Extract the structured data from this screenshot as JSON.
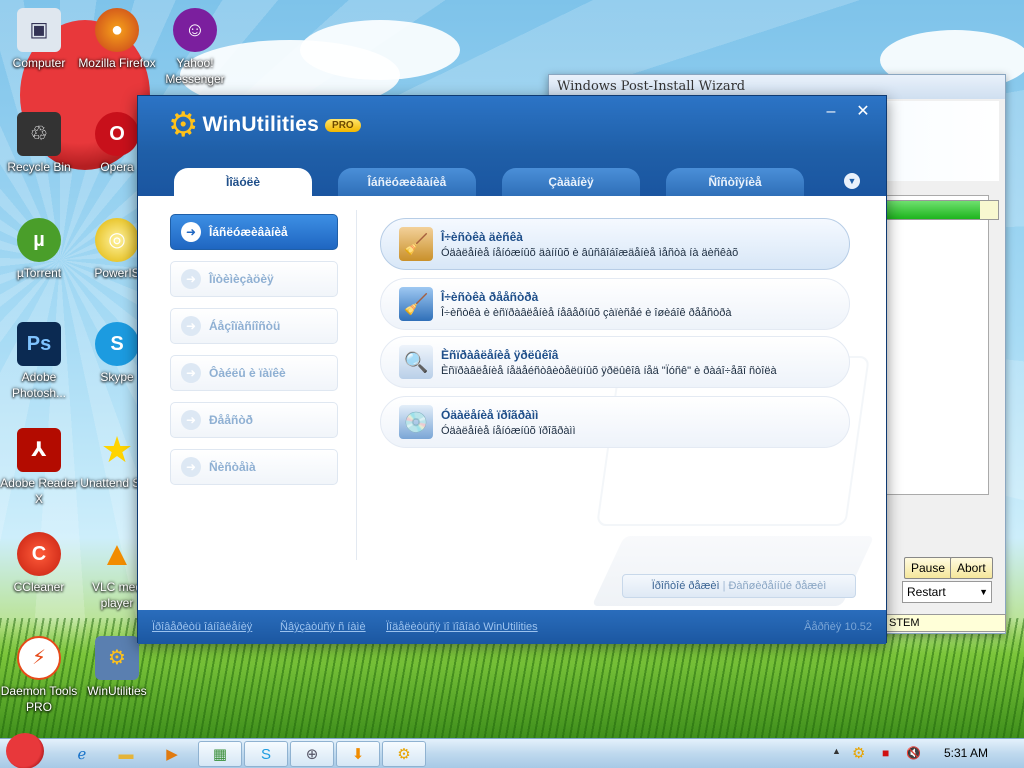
{
  "desktop": {
    "icons": [
      {
        "label": "Computer",
        "icon": "computer-icon"
      },
      {
        "label": "Mozilla Firefox",
        "icon": "firefox-icon"
      },
      {
        "label": "Yahoo! Messenger",
        "icon": "yahoo-messenger-icon"
      },
      {
        "label": "Recycle Bin",
        "icon": "recycle-bin-icon"
      },
      {
        "label": "Opera",
        "icon": "opera-icon"
      },
      {
        "label": "µTorrent",
        "icon": "utorrent-icon"
      },
      {
        "label": "PowerIS",
        "icon": "poweriso-icon"
      },
      {
        "label": "Adobe Photosh...",
        "icon": "photoshop-icon"
      },
      {
        "label": "Skype",
        "icon": "skype-icon"
      },
      {
        "label": "Adobe Reader X",
        "icon": "adobe-reader-icon"
      },
      {
        "label": "Unattend Soft",
        "icon": "star-icon"
      },
      {
        "label": "CCleaner",
        "icon": "ccleaner-icon"
      },
      {
        "label": "VLC med player",
        "icon": "vlc-icon"
      },
      {
        "label": "Daemon Tools PRO",
        "icon": "daemon-tools-icon"
      },
      {
        "label": "WinUtilities",
        "icon": "winutilities-icon"
      }
    ]
  },
  "wizard": {
    "title": "Windows Post-Install Wizard",
    "pause_label": "Pause",
    "abort_label": "Abort",
    "restart_value": "Restart",
    "status_text": "STEM",
    "progress": 0.85
  },
  "app": {
    "name": "WinUtilities",
    "badge": "PRO",
    "tabs": [
      "Ìîäóëè",
      "Îáñëóæèâàíèå",
      "Çàäàíèÿ",
      "Ñîñòîÿíèå"
    ],
    "nav": [
      "Îáñëóæèâàíèå",
      "Îïòèìèçàöèÿ",
      "Áåçîïàñíîñòü",
      "Ôàéëû è ïàïêè",
      "Ðååñòð",
      "Ñèñòåìà"
    ],
    "features": [
      {
        "title": "Î÷èñòêà äèñêà",
        "desc": "Óäàëåíèå íåíóæíûõ äàííûõ è âûñâîáîæäåíèå ìåñòà íà äèñêàõ",
        "icon": "disk-cleanup-icon"
      },
      {
        "title": "Î÷èñòêà ðååñòðà",
        "desc": "Î÷èñòêà è èñïðàâëåíèå íåâåðíûõ çàïèñåé è îøèáîê ðååñòðà",
        "icon": "registry-cleanup-icon"
      },
      {
        "title": "Èñïðàâëåíèå ÿðëûêîâ",
        "desc": "Èñïðàâëåíèå íåäåéñòâèòåëüíûõ ÿðëûêîâ íåä \"Ïóñê\" è ðàáî÷åãî ñòîëà",
        "icon": "shortcut-fix-icon"
      },
      {
        "title": "Óäàëåíèå ïðîãðàìì",
        "desc": "Óäàëåíèå íåíóæíûõ ïðîãðàìì",
        "icon": "uninstall-icon"
      }
    ],
    "mode": {
      "basic": "Ïðîñòîé ðåæèì",
      "advanced": "Ðàñøèðåííûé ðåæèì"
    },
    "footer": {
      "link1": "Ïðîâåðèòü îáíîâëåíèÿ",
      "link2": "Ñâÿçàòüñÿ ñ íàìè",
      "link3": "Ïîäåëèòüñÿ ïî ïîâîäó WinUtilities",
      "version": "Âåðñèÿ 10.52"
    }
  },
  "taskbar": {
    "clock": "5:31 AM",
    "items": [
      "internet-explorer-icon",
      "folder-icon",
      "media-player-icon",
      "winpim-icon",
      "skype-icon",
      "network-icon",
      "download-icon",
      "winutilities-icon"
    ]
  }
}
